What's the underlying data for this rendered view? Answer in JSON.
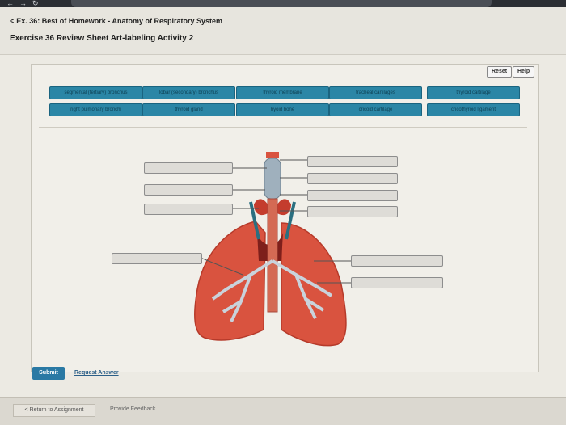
{
  "browser": {
    "url": "session.masteringandp.com/myct/itemView?assignmentProblemID=...&offset=next"
  },
  "header": {
    "breadcrumb": "Ex. 36: Best of Homework - Anatomy of Respiratory System",
    "exercise_title": "Exercise 36 Review Sheet Art-labeling Activity 2"
  },
  "toolbar": {
    "reset_label": "Reset",
    "help_label": "Help"
  },
  "label_bank": [
    "segmental (tertiary) bronchus",
    "lobar (secondary) bronchus",
    "thyroid membrane",
    "tracheal cartilages",
    "thyroid cartilage",
    "right pulmonary bronchi",
    "thyroid gland",
    "hyoid bone",
    "cricoid cartilage",
    "cricothyroid ligament"
  ],
  "footer": {
    "submit_label": "Submit",
    "request_answer_label": "Request Answer",
    "return_label": "< Return to Assignment",
    "feedback_label": "Provide Feedback"
  },
  "colors": {
    "chip": "#2b86a6",
    "submit": "#2a79a4",
    "lung": "#d9533f",
    "airway": "#c9d3dc"
  }
}
